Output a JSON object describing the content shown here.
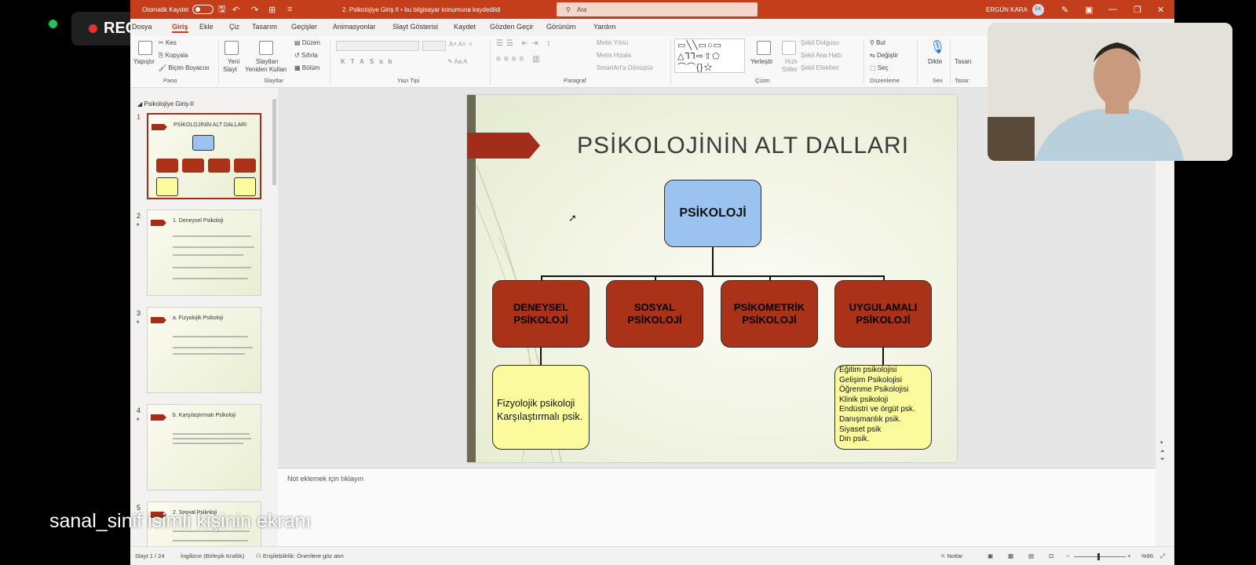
{
  "meeting": {
    "rec_label": "REC",
    "share_label": "sanal_sinif isimli kişinin ekranı"
  },
  "titlebar": {
    "autosave": "Otomatik Kaydet",
    "document_title": "2. Psikolojiye Giriş II  •  bu bilgisayar konumuna kaydedildi",
    "search_placeholder": "Ara",
    "user_name": "ERGÜN KARA",
    "user_initials": "EK"
  },
  "tabs": [
    "Dosya",
    "Giriş",
    "Ekle",
    "Çiz",
    "Tasarım",
    "Geçişler",
    "Animasyonlar",
    "Slayt Gösterisi",
    "Kaydet",
    "Gözden Geçir",
    "Görünüm",
    "Yardım"
  ],
  "ribbon": {
    "paste": "Yapıştır",
    "cut": "Kes",
    "copy": "Kopyala",
    "format_painter": "Biçim Boyacısı",
    "new_slide": "Yeni",
    "new_slide_2": "Slayt",
    "reuse_slides": "Slaytları",
    "reuse_slides_2": "Yeniden Kullan",
    "layout": "Düzen",
    "reset": "Sıfırla",
    "section": "Bölüm",
    "text_direction": "Metin Yönü",
    "align_text": "Metni Hizala",
    "smartart": "SmartArt'a Dönüştür",
    "arrange": "Yerleştir",
    "quick_styles": "Hızlı",
    "quick_styles_2": "Stiller",
    "shape_fill": "Şekil Dolgusu",
    "shape_outline": "Şekil Ana Hattı",
    "shape_effects": "Şekil Efektleri",
    "find": "Bul",
    "replace": "Değiştir",
    "select": "Seç",
    "dictate": "Dikte",
    "designer": "Tasarı",
    "groups": {
      "clipboard": "Pano",
      "slides": "Slaytlar",
      "font": "Yazı Tipi",
      "paragraph": "Paragraf",
      "drawing": "Çizim",
      "editing": "Düzenleme",
      "voice": "Ses",
      "designer": "Tasar"
    }
  },
  "thumbnails": {
    "section": "Psikolojiye Giriş-II",
    "items": [
      {
        "num": "1",
        "title": "PSİKOLOJİNİN ALT DALLARI"
      },
      {
        "num": "2",
        "title": "1. Deneysel Psikoloji"
      },
      {
        "num": "3",
        "title": "a. Fizyolojik Psikoloji"
      },
      {
        "num": "4",
        "title": "b. Karşılaştırmalı Psikoloji"
      },
      {
        "num": "5",
        "title": "2. Sosyal Psikoloji"
      }
    ]
  },
  "slide": {
    "title": "PSİKOLOJİNİN  ALT DALLARI",
    "root": "PSİKOLOJİ",
    "branches": [
      "DENEYSEL PSİKOLOJİ",
      "SOSYAL PSİKOLOJİ",
      "PSİKOMETRİK PSİKOLOJİ",
      "UYGULAMALI PSİKOLOJİ"
    ],
    "left_leaf": [
      "Fizyolojik psikoloji",
      "Karşılaştırmalı psik."
    ],
    "right_leaf": [
      "Eğitim psikolojisi",
      "Gelişim Psikolojisi",
      "Öğrenme Psikolojisi",
      "Klinik psikoloji",
      "Endüstri ve örgüt psk.",
      "Danışmanlık psik.",
      "Siyaset psik",
      "Din psik."
    ]
  },
  "notes_placeholder": "Not eklemek için tıklayın",
  "status": {
    "slide_counter": "Slayt 1 / 24",
    "language": "İngilizce (Birleşik Krallık)",
    "accessibility": "Erişilebilirlik: Önerilere göz atın",
    "notes": "Notlar",
    "zoom": "%96"
  }
}
